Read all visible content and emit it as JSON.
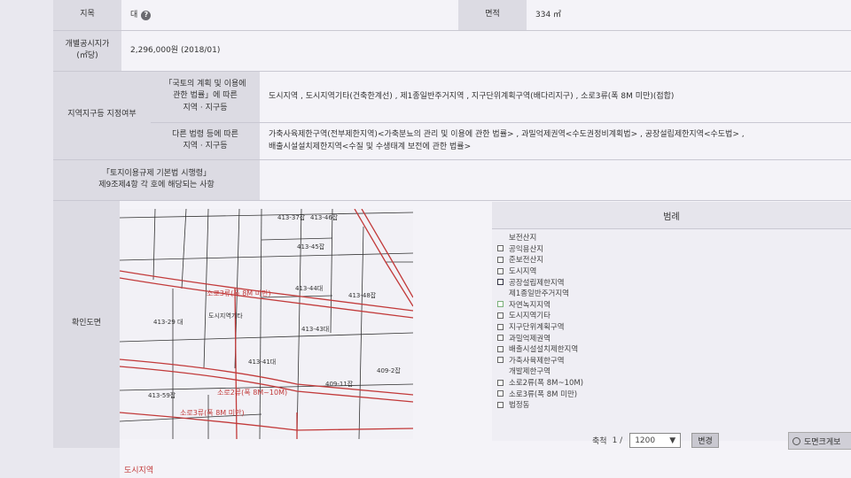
{
  "rows": {
    "jimok": {
      "label": "지목",
      "value": "대"
    },
    "area": {
      "label": "면적",
      "value": "334 ㎡"
    },
    "price": {
      "label_line1": "개별공시지가",
      "label_line2": "(㎡당)",
      "value": "2,296,000원 (2018/01)"
    },
    "zone": {
      "label": "지역지구등 지정여부",
      "sub1": {
        "label_line1": "「국토의 계획 및 이용에",
        "label_line2": "관한 법률」에 따른",
        "label_line3": "지역 · 지구등",
        "value": "도시지역 , 도시지역기타(건축한계선) , 제1종일반주거지역 , 지구단위계획구역(배다리지구) , 소로3류(폭 8M 미만)(접합)"
      },
      "sub2": {
        "label_line1": "다른 법령 등에 따른",
        "label_line2": "지역 · 지구등",
        "value_line1": "가축사육제한구역(전부제한지역)<가축분뇨의 관리 및 이용에 관한 법률> , 과밀억제권역<수도권정비계획법> , 공장설립제한지역<수도법> ,",
        "value_line2": "배출시설설치제한지역<수질 및 수생태계 보전에 관한 법률>"
      }
    },
    "enforce": {
      "label_line1": "「토지이용규제 기본법 시행령」",
      "label_line2": "제9조제4항 각 호에 해당되는 사항",
      "value": ""
    },
    "map": {
      "label": "확인도면"
    }
  },
  "map_labels": [
    "413-37잡",
    "413-46잡",
    "413-45잡",
    "413-44대",
    "413-48잡",
    "413-29 대",
    "413-43대",
    "409-2잡",
    "409-11잡",
    "413-59잡",
    "413-41대",
    "도시지역기타",
    "소로3류(폭 8M 미만)",
    "소로2류(폭 8M~10M)"
  ],
  "legend": {
    "title": "범례",
    "items": [
      {
        "label": "보전산지",
        "box": "none"
      },
      {
        "label": "공익용산지",
        "box": "plain"
      },
      {
        "label": "준보전산지",
        "box": "plain"
      },
      {
        "label": "도시지역",
        "box": "plain"
      },
      {
        "label": "공장설립제한지역",
        "box": "navy"
      },
      {
        "label": "제1종일반주거지역",
        "box": "none"
      },
      {
        "label": "자연녹지지역",
        "box": "green"
      },
      {
        "label": "도시지역기타",
        "box": "plain"
      },
      {
        "label": "지구단위계획구역",
        "box": "plain"
      },
      {
        "label": "과밀억제권역",
        "box": "plain"
      },
      {
        "label": "배출시설설치제한지역",
        "box": "plain"
      },
      {
        "label": "가축사육제한구역",
        "box": "plain"
      },
      {
        "label": "개발제한구역",
        "box": "none"
      },
      {
        "label": "소로2류(폭 8M~10M)",
        "box": "plain"
      },
      {
        "label": "소로3류(폭 8M 미만)",
        "box": "plain"
      },
      {
        "label": "법정동",
        "box": "plain"
      }
    ]
  },
  "scale": {
    "label": "축척",
    "prefix": "1 /",
    "value": "1200",
    "change_label": "변경"
  },
  "zoom_button": {
    "label": "도면크게보"
  },
  "footer_text": "도시지역",
  "colors": {
    "road_red": "#c23a3a",
    "parcel_line": "#333333",
    "header_bg": "#dcdbe3"
  }
}
